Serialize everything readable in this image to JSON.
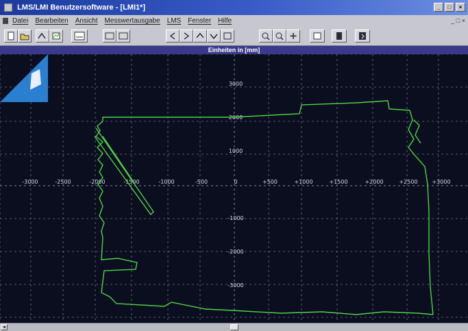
{
  "window": {
    "title": "LMS/LMI Benutzersoftware - [LMI1*]",
    "controls": [
      "_",
      "□",
      "×"
    ]
  },
  "menu": {
    "items": [
      "Datei",
      "Bearbeiten",
      "Ansicht",
      "Messwertausgabe",
      "LMS",
      "Fenster",
      "Hilfe"
    ],
    "right_control": "_ □ ×"
  },
  "toolbar": {
    "buttons": [
      {
        "icon": "new-document-icon"
      },
      {
        "icon": "open-folder-icon"
      },
      {
        "icon": "connect-icon"
      },
      {
        "icon": "chart-icon"
      },
      {
        "icon": "export-icon"
      },
      {
        "icon": "arrow-left-icon"
      },
      {
        "icon": "arrow-right-icon"
      },
      {
        "icon": "arrow-up-icon"
      },
      {
        "icon": "arrow-down-icon"
      },
      {
        "icon": "zoom-in-icon"
      },
      {
        "icon": "zoom-out-icon"
      },
      {
        "icon": "zoom-fit-icon"
      },
      {
        "icon": "print-icon"
      },
      {
        "icon": "paragraph-icon"
      },
      {
        "icon": "help-icon"
      }
    ]
  },
  "plot": {
    "header": "Einheiten in [mm]",
    "x_ticks": [
      "-3000",
      "-2500",
      "-2000",
      "-1500",
      "-1000",
      "-500",
      "0",
      "+500",
      "+1000",
      "+1500",
      "+2000",
      "+2500",
      "+3000"
    ],
    "y_ticks": [
      "3000",
      "2000",
      "1000",
      "0",
      "-1000",
      "-2000",
      "-3000"
    ],
    "colors": {
      "background": "#0b0e1e",
      "grid": "#6c7090",
      "trace": "#4fd24a",
      "text": "#d8d8e8"
    }
  },
  "scrollbar": {
    "left_arrow": "◂"
  }
}
